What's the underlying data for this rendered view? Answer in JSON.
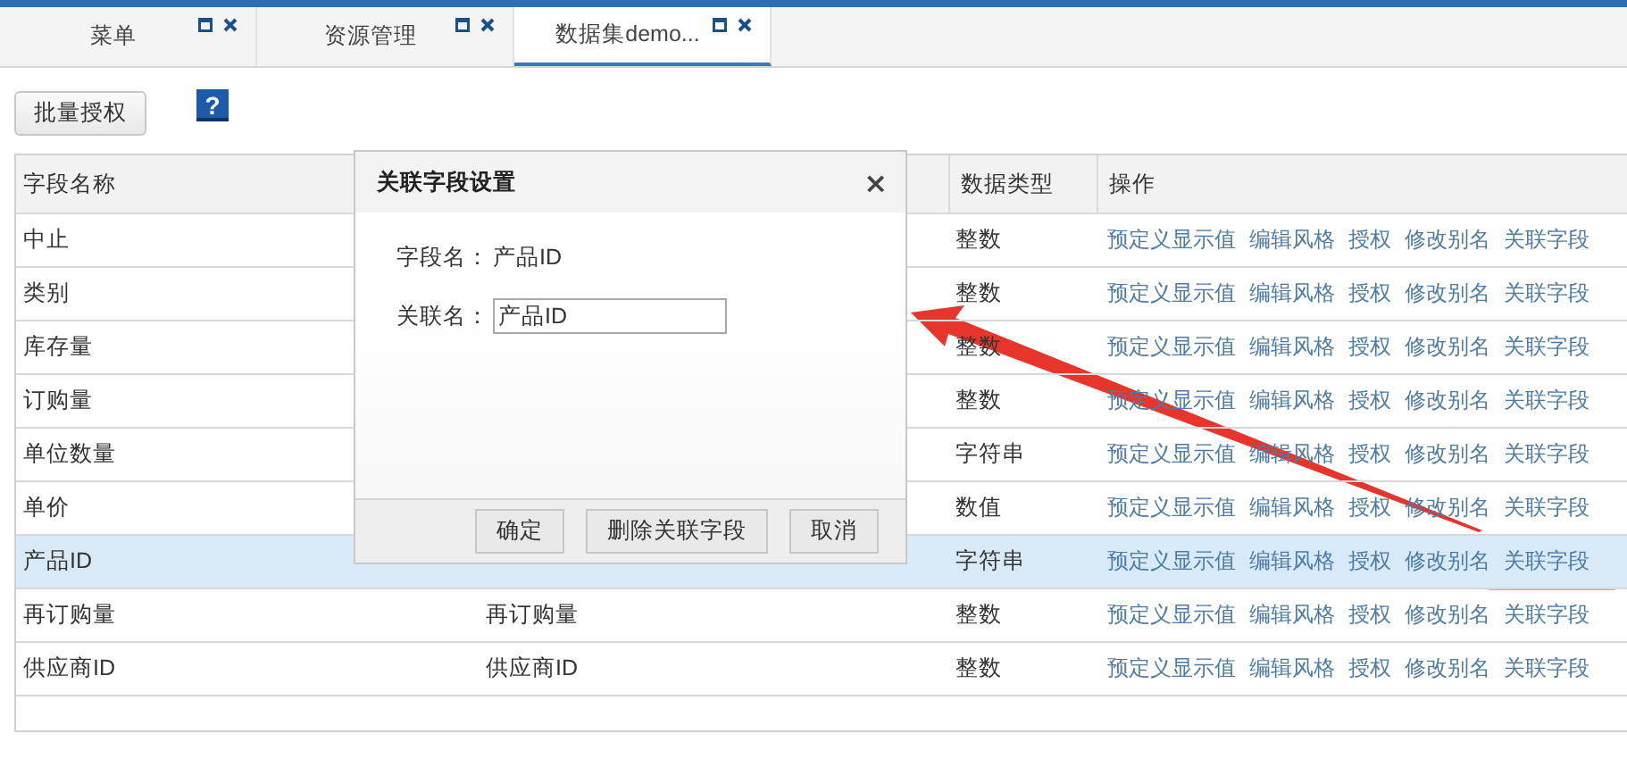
{
  "tabs": [
    {
      "label": "菜单",
      "selected": false
    },
    {
      "label": "资源管理",
      "selected": false
    },
    {
      "label": "数据集demo...",
      "selected": true
    }
  ],
  "toolbar": {
    "batch_button": "批量授权",
    "help_button": "?"
  },
  "table": {
    "columns": [
      "字段名称",
      "",
      "数据类型",
      "操作"
    ],
    "rows": [
      {
        "name": "中止",
        "alias": "",
        "type": "整数",
        "selected": false,
        "actions": [
          "预定义显示值",
          "编辑风格",
          "授权",
          "修改别名",
          "关联字段"
        ]
      },
      {
        "name": "类别",
        "alias": "",
        "type": "整数",
        "selected": false,
        "actions": [
          "预定义显示值",
          "编辑风格",
          "授权",
          "修改别名",
          "关联字段"
        ]
      },
      {
        "name": "库存量",
        "alias": "",
        "type": "整数",
        "selected": false,
        "actions": [
          "预定义显示值",
          "编辑风格",
          "授权",
          "修改别名",
          "关联字段"
        ]
      },
      {
        "name": "订购量",
        "alias": "",
        "type": "整数",
        "selected": false,
        "actions": [
          "预定义显示值",
          "编辑风格",
          "授权",
          "修改别名",
          "关联字段"
        ]
      },
      {
        "name": "单位数量",
        "alias": "",
        "type": "字符串",
        "selected": false,
        "actions": [
          "预定义显示值",
          "编辑风格",
          "授权",
          "修改别名",
          "关联字段"
        ]
      },
      {
        "name": "单价",
        "alias": "",
        "type": "数值",
        "selected": false,
        "actions": [
          "预定义显示值",
          "编辑风格",
          "授权",
          "修改别名",
          "关联字段"
        ]
      },
      {
        "name": "产品ID",
        "alias": "",
        "type": "字符串",
        "selected": true,
        "actions": [
          "预定义显示值",
          "编辑风格",
          "授权",
          "修改别名",
          "关联字段"
        ]
      },
      {
        "name": "再订购量",
        "alias": "再订购量",
        "type": "整数",
        "selected": false,
        "actions": [
          "预定义显示值",
          "编辑风格",
          "授权",
          "修改别名",
          "关联字段"
        ]
      },
      {
        "name": "供应商ID",
        "alias": "供应商ID",
        "type": "整数",
        "selected": false,
        "actions": [
          "预定义显示值",
          "编辑风格",
          "授权",
          "修改别名",
          "关联字段"
        ]
      }
    ]
  },
  "dialog": {
    "title": "关联字段设置",
    "close": "×",
    "field_label": "字段名：",
    "field_value": "产品ID",
    "link_label": "关联名：",
    "link_value": "产品ID",
    "buttons": [
      "确定",
      "删除关联字段",
      "取消"
    ]
  }
}
